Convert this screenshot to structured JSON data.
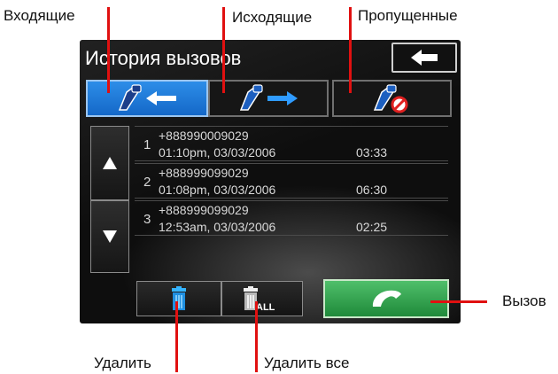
{
  "callouts": {
    "incoming": "Входящие",
    "outgoing": "Исходящие",
    "missed": "Пропущенные",
    "call": "Вызов",
    "delete": "Удалить",
    "delete_all": "Удалить все"
  },
  "screen": {
    "title": "История вызовов",
    "back_icon": "arrow-left-icon",
    "tabs": [
      {
        "icon": "incoming-call-icon",
        "active": true
      },
      {
        "icon": "outgoing-call-icon",
        "active": false
      },
      {
        "icon": "missed-call-icon",
        "active": false
      }
    ],
    "calls": [
      {
        "index": "1",
        "number": "+888990009029",
        "datetime": "01:10pm, 03/03/2006",
        "duration": "03:33"
      },
      {
        "index": "2",
        "number": "+888999099029",
        "datetime": "01:08pm, 03/03/2006",
        "duration": "06:30"
      },
      {
        "index": "3",
        "number": "+888999099029",
        "datetime": "12:53am, 03/03/2006",
        "duration": "02:25"
      }
    ],
    "delete_all_icon_text": "ALL",
    "colors": {
      "accent_blue": "#1a73d9",
      "call_green": "#2fa04a",
      "callout_line": "#e01010"
    }
  }
}
